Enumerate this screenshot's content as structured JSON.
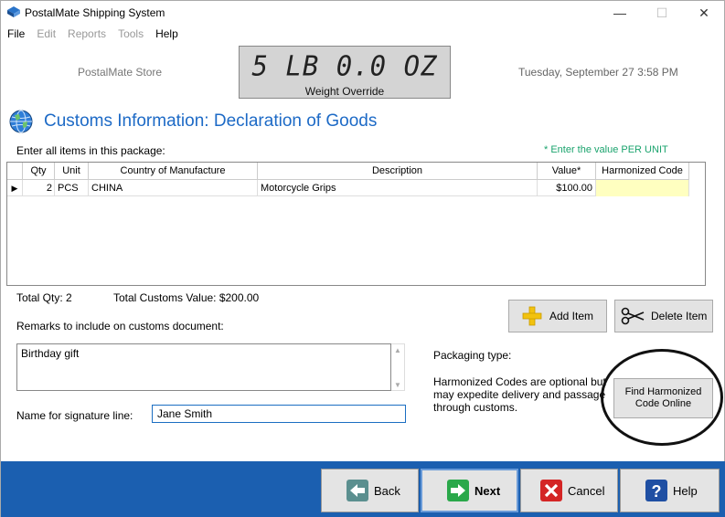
{
  "window": {
    "title": "PostalMate Shipping System",
    "controls": {
      "minimize": "—",
      "maximize": "☐",
      "close": "✕"
    }
  },
  "menu": [
    {
      "label": "File",
      "enabled": true
    },
    {
      "label": "Edit",
      "enabled": false
    },
    {
      "label": "Reports",
      "enabled": false
    },
    {
      "label": "Tools",
      "enabled": false
    },
    {
      "label": "Help",
      "enabled": true
    }
  ],
  "header": {
    "store_name": "PostalMate Store",
    "weight": "5 LB 0.0 OZ",
    "weight_label": "Weight Override",
    "datetime": "Tuesday, September 27  3:58 PM"
  },
  "section": {
    "title": "Customs Information: Declaration of Goods",
    "enter_items_label": "Enter all items in this package:",
    "value_note": "* Enter the value PER UNIT"
  },
  "grid": {
    "columns": [
      "Qty",
      "Unit",
      "Country of Manufacture",
      "Description",
      "Value*",
      "Harmonized Code"
    ],
    "rows": [
      {
        "indicator": "▶",
        "qty": "2",
        "unit": "PCS",
        "country": "CHINA",
        "description": "Motorcycle Grips",
        "value": "$100.00",
        "hs_code": ""
      }
    ]
  },
  "totals": {
    "qty": "Total Qty: 2",
    "value": "Total Customs Value: $200.00"
  },
  "buttons": {
    "add_item": "Add Item",
    "delete_item": "Delete Item",
    "find_hs": "Find Harmonized Code Online"
  },
  "remarks": {
    "label": "Remarks to include on customs document:",
    "value": "Birthday gift"
  },
  "signature": {
    "label": "Name for signature line:",
    "value": "Jane Smith"
  },
  "packaging": {
    "label": "Packaging type:",
    "hs_note": "Harmonized Codes are optional but may expedite delivery and passage through customs."
  },
  "nav": {
    "back": "Back",
    "next": "Next",
    "cancel": "Cancel",
    "help": "Help"
  },
  "colors": {
    "accent": "#1d6ac6",
    "bottom_bar": "#1b5fb0",
    "note_green": "#1aa36d",
    "hs_cell": "#ffffc0"
  }
}
